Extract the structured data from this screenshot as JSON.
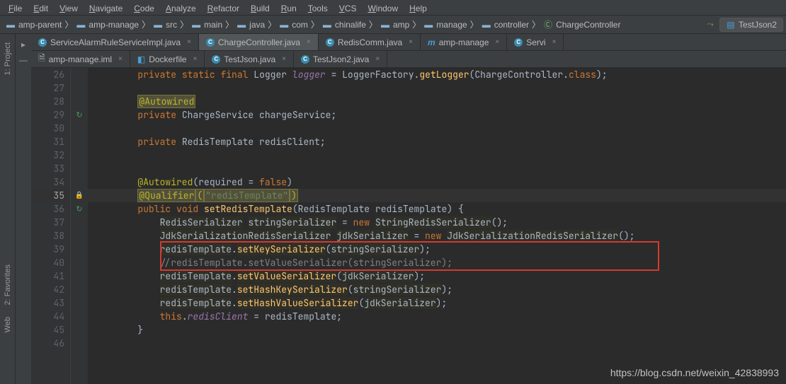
{
  "menu": {
    "items": [
      "File",
      "Edit",
      "View",
      "Navigate",
      "Code",
      "Analyze",
      "Refactor",
      "Build",
      "Run",
      "Tools",
      "VCS",
      "Window",
      "Help"
    ]
  },
  "breadcrumb": {
    "items": [
      {
        "label": "amp-parent",
        "icon": "folder"
      },
      {
        "label": "amp-manage",
        "icon": "folder"
      },
      {
        "label": "src",
        "icon": "folder"
      },
      {
        "label": "main",
        "icon": "folder"
      },
      {
        "label": "java",
        "icon": "folder"
      },
      {
        "label": "com",
        "icon": "folder"
      },
      {
        "label": "chinalife",
        "icon": "folder"
      },
      {
        "label": "amp",
        "icon": "folder"
      },
      {
        "label": "manage",
        "icon": "folder"
      },
      {
        "label": "controller",
        "icon": "folder"
      },
      {
        "label": "ChargeController",
        "icon": "class"
      }
    ],
    "run_config": "TestJson2"
  },
  "tabs_row1": [
    {
      "label": "ServiceAlarmRuleServiceImpl.java",
      "icon": "c",
      "active": false
    },
    {
      "label": "ChargeController.java",
      "icon": "c",
      "active": true
    },
    {
      "label": "RedisComm.java",
      "icon": "c",
      "active": false
    },
    {
      "label": "amp-manage",
      "icon": "m",
      "active": false
    },
    {
      "label": "Servi",
      "icon": "c",
      "active": false
    }
  ],
  "tabs_row2": [
    {
      "label": "amp-manage.iml",
      "icon": "file",
      "active": false
    },
    {
      "label": "Dockerfile",
      "icon": "docker",
      "active": false
    },
    {
      "label": "TestJson.java",
      "icon": "c",
      "active": false
    },
    {
      "label": "TestJson2.java",
      "icon": "c",
      "active": false
    }
  ],
  "tool_windows": {
    "project": "1: Project",
    "favorites": "2: Favorites",
    "web": "Web"
  },
  "code": {
    "current_line": 35,
    "gutter": [
      26,
      27,
      28,
      29,
      30,
      31,
      32,
      33,
      34,
      35,
      36,
      37,
      38,
      39,
      40,
      41,
      42,
      43,
      44,
      45,
      46
    ],
    "indicators": {
      "29": "vcs",
      "35": "lock",
      "36": "vcs"
    },
    "lines": {
      "26": {
        "tokens": [
          [
            "        ",
            ""
          ],
          [
            "private",
            "key"
          ],
          [
            " ",
            ""
          ],
          [
            "static",
            "key"
          ],
          [
            " ",
            ""
          ],
          [
            "final",
            "key"
          ],
          [
            " ",
            ""
          ],
          [
            "Logger",
            "type"
          ],
          [
            " ",
            ""
          ],
          [
            "logger",
            "field"
          ],
          [
            " = ",
            "punct"
          ],
          [
            "LoggerFactory",
            "type"
          ],
          [
            ".",
            "punct"
          ],
          [
            "getLogger",
            "method"
          ],
          [
            "(",
            "punct"
          ],
          [
            "ChargeController",
            "type"
          ],
          [
            ".",
            "punct"
          ],
          [
            "class",
            "key"
          ],
          [
            ")",
            "punct"
          ],
          [
            ";",
            "punct"
          ]
        ]
      },
      "27": {
        "tokens": [
          [
            "",
            ""
          ]
        ]
      },
      "28": {
        "tokens": [
          [
            "        ",
            ""
          ],
          [
            "@Autowired",
            "ann-box"
          ]
        ]
      },
      "29": {
        "tokens": [
          [
            "        ",
            ""
          ],
          [
            "private",
            "key"
          ],
          [
            " ",
            ""
          ],
          [
            "ChargeService",
            "type"
          ],
          [
            " ",
            ""
          ],
          [
            "chargeService",
            "ident"
          ],
          [
            ";",
            "punct"
          ]
        ]
      },
      "30": {
        "tokens": [
          [
            "",
            ""
          ]
        ]
      },
      "31": {
        "tokens": [
          [
            "        ",
            ""
          ],
          [
            "private",
            "key"
          ],
          [
            " ",
            ""
          ],
          [
            "RedisTemplate",
            "type"
          ],
          [
            " ",
            ""
          ],
          [
            "redisClient",
            "ident"
          ],
          [
            ";",
            "punct"
          ]
        ]
      },
      "32": {
        "tokens": [
          [
            "",
            ""
          ]
        ]
      },
      "33": {
        "tokens": [
          [
            "",
            ""
          ]
        ]
      },
      "34": {
        "tokens": [
          [
            "        ",
            ""
          ],
          [
            "@Autowired",
            "ann"
          ],
          [
            "(",
            "punct"
          ],
          [
            "required",
            "ident"
          ],
          [
            " = ",
            "punct"
          ],
          [
            "false",
            "key"
          ],
          [
            ")",
            "punct"
          ]
        ]
      },
      "35": {
        "tokens": [
          [
            "        ",
            ""
          ],
          [
            "@Qualifier",
            "ann-box2"
          ],
          [
            "(",
            "ann-box2"
          ],
          [
            "\"redisTemplate\"",
            "str-box"
          ],
          [
            ")",
            "ann-box2"
          ]
        ]
      },
      "36": {
        "tokens": [
          [
            "        ",
            ""
          ],
          [
            "public",
            "key"
          ],
          [
            " ",
            ""
          ],
          [
            "void",
            "key"
          ],
          [
            " ",
            ""
          ],
          [
            "setRedisTemplate",
            "method"
          ],
          [
            "(",
            "punct"
          ],
          [
            "RedisTemplate",
            "type"
          ],
          [
            " ",
            ""
          ],
          [
            "redisTemplate",
            "ident"
          ],
          [
            ")",
            "punct"
          ],
          [
            " ",
            "punct"
          ],
          [
            "{",
            "punct"
          ]
        ]
      },
      "37": {
        "tokens": [
          [
            "            ",
            ""
          ],
          [
            "RedisSerializer",
            "type-w"
          ],
          [
            " ",
            ""
          ],
          [
            "stringSerializer",
            "ident-w"
          ],
          [
            " = ",
            "punct"
          ],
          [
            "new",
            "key"
          ],
          [
            " ",
            ""
          ],
          [
            "StringRedisSerializer",
            "type-w"
          ],
          [
            "()",
            "punct"
          ],
          [
            ";",
            "punct"
          ]
        ]
      },
      "38": {
        "tokens": [
          [
            "            ",
            ""
          ],
          [
            "JdkSerializationRedisSerializer",
            "type-w"
          ],
          [
            " ",
            ""
          ],
          [
            "jdkSerializer",
            "ident-w"
          ],
          [
            " = ",
            "punct"
          ],
          [
            "new",
            "key"
          ],
          [
            " ",
            ""
          ],
          [
            "JdkSerializationRedisSerializer",
            "type-w"
          ],
          [
            "()",
            "punct"
          ],
          [
            ";",
            "punct"
          ]
        ]
      },
      "39": {
        "tokens": [
          [
            "            ",
            ""
          ],
          [
            "redisTemplate",
            "ident-w"
          ],
          [
            ".",
            "punct"
          ],
          [
            "setKeySerializer",
            "method-w"
          ],
          [
            "(",
            "punct"
          ],
          [
            "stringSerializer",
            "ident-w"
          ],
          [
            ")",
            "punct"
          ],
          [
            ";",
            "punct"
          ]
        ]
      },
      "40": {
        "tokens": [
          [
            "            ",
            ""
          ],
          [
            "//redisTemplate.setValueSerializer(stringSerializer);",
            "comment"
          ]
        ]
      },
      "41": {
        "tokens": [
          [
            "            ",
            ""
          ],
          [
            "redisTemplate",
            "ident-w"
          ],
          [
            ".",
            "punct"
          ],
          [
            "setValueSerializer",
            "method-w"
          ],
          [
            "(",
            "punct"
          ],
          [
            "jdkSerializer",
            "ident-w"
          ],
          [
            ")",
            "punct"
          ],
          [
            ";",
            "punct"
          ]
        ]
      },
      "42": {
        "tokens": [
          [
            "            ",
            ""
          ],
          [
            "redisTemplate",
            "ident-w"
          ],
          [
            ".",
            "punct"
          ],
          [
            "setHashKeySerializer",
            "method-w"
          ],
          [
            "(",
            "punct"
          ],
          [
            "stringSerializer",
            "ident-w"
          ],
          [
            ")",
            "punct"
          ],
          [
            ";",
            "punct"
          ]
        ]
      },
      "43": {
        "tokens": [
          [
            "            ",
            ""
          ],
          [
            "redisTemplate",
            "ident-w"
          ],
          [
            ".",
            "punct"
          ],
          [
            "setHashValueSerializer",
            "method-w"
          ],
          [
            "(",
            "punct"
          ],
          [
            "jdkSerializer",
            "ident-w"
          ],
          [
            ")",
            "punct"
          ],
          [
            ";",
            "punct"
          ]
        ]
      },
      "44": {
        "tokens": [
          [
            "            ",
            ""
          ],
          [
            "this",
            "key"
          ],
          [
            ".",
            "punct"
          ],
          [
            "redisClient",
            "field"
          ],
          [
            " = ",
            "punct"
          ],
          [
            "redisTemplate",
            "ident"
          ],
          [
            ";",
            "punct"
          ]
        ]
      },
      "45": {
        "tokens": [
          [
            "        ",
            ""
          ],
          [
            "}",
            "punct"
          ]
        ]
      },
      "46": {
        "tokens": [
          [
            "",
            ""
          ]
        ]
      }
    }
  },
  "watermark": "https://blog.csdn.net/weixin_42838993"
}
